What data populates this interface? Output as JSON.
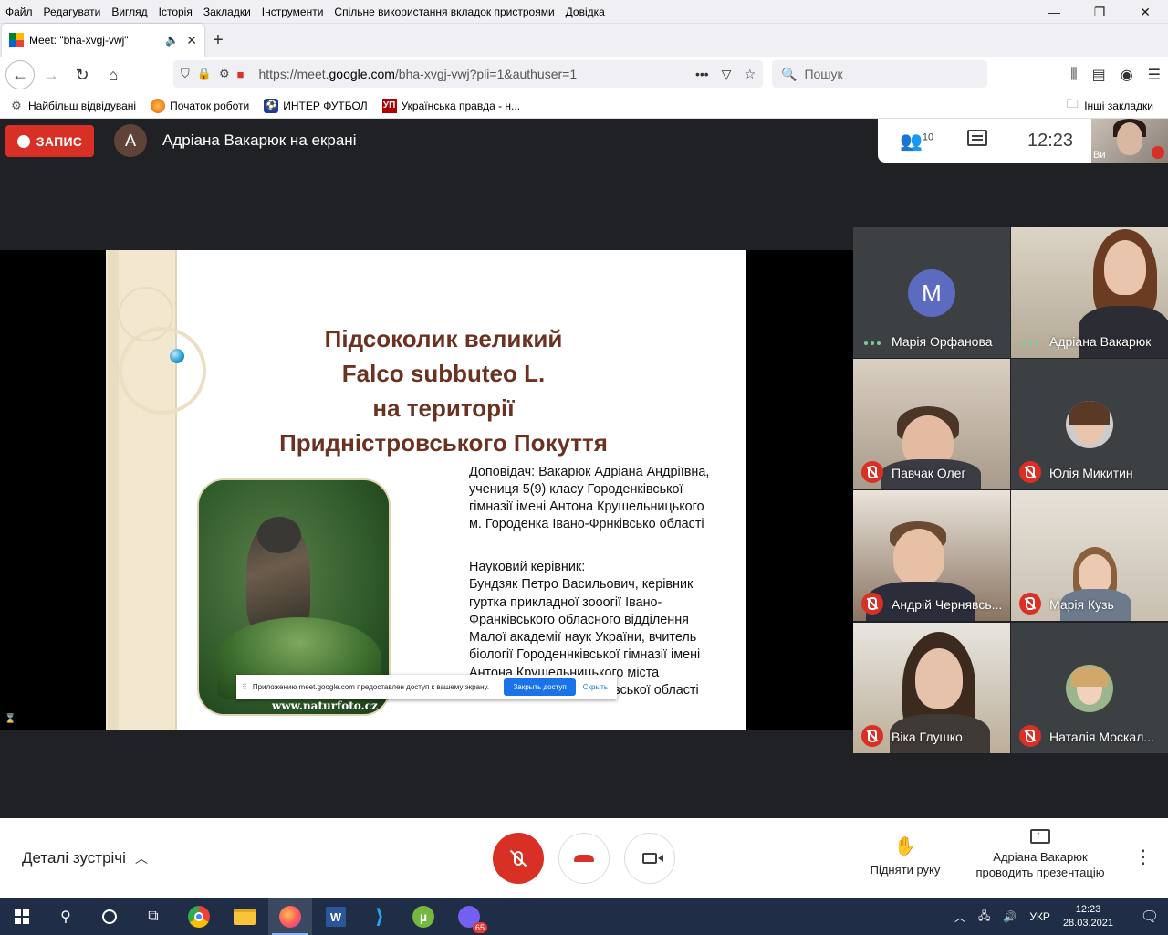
{
  "browser": {
    "menu": [
      "Файл",
      "Редагувати",
      "Вигляд",
      "Історія",
      "Закладки",
      "Інструменти",
      "Спільне використання вкладок пристроями",
      "Довідка"
    ],
    "tab_title": "Meet: \"bha-xvgj-vwj\"",
    "url_prefix": "https://meet.",
    "url_host": "google.com",
    "url_rest": "/bha-xvgj-vwj?pli=1&authuser=1",
    "search_placeholder": "Пошук",
    "bookmarks": [
      {
        "label": "Найбільш відвідувані",
        "icon": "gear-icon"
      },
      {
        "label": "Початок роботи",
        "icon": "firefox-icon"
      },
      {
        "label": "ИНТЕР ФУТБОЛ",
        "icon": "football-icon"
      },
      {
        "label": "Українська правда - н...",
        "icon": "up-icon"
      }
    ],
    "other_bookmarks": "Інші закладки"
  },
  "meet": {
    "record_label": "ЗАПИС",
    "presenter_initial": "А",
    "presenter_text": "Адріана Вакарюк на екрані",
    "participants_count": "10",
    "time": "12:23",
    "self_label": "Ви",
    "colors": {
      "record": "#d93025",
      "mic_off": "#d93025",
      "avatar_m": "#5c6bc0"
    }
  },
  "slide": {
    "title": "Підсоколик великий\nFalco subbuteo L.\nна території\nПридністровського Покуття",
    "speaker": " Доповідач: Вакарюк Адріана Андріївна,\nучениця 5(9) класу Городенківської\nгімназії імені Антона Крушельницького\nм. Городенка Івано-Фрнківсько області",
    "advisor": "  Науковий керівник:\n  Бундзяк Петро Васильович, керівник\nгуртка прикладної зооогії Івано-\nФранківського обласного відділення\nМалої академії наук України,  вчитель\nбіології Городеннківської гімназії імені\nАнтона Крушельницького міста\nГороденка Івано-Франківської області",
    "watermark": "www.naturfoto.cz"
  },
  "share_bar": {
    "message": "Приложению meet.google.com предоставлен доступ к вашему экрану.",
    "stop_label": "Закрыть доступ",
    "hide_label": "Скрыть"
  },
  "participants": [
    {
      "name": "Марія Орфанова",
      "status": "speaking"
    },
    {
      "name": "Адріана Вакарюк",
      "status": "speaking"
    },
    {
      "name": "Павчак Олег",
      "status": "muted"
    },
    {
      "name": "Юлія Микитин",
      "status": "muted"
    },
    {
      "name": "Андрій Чернявсь...",
      "status": "muted"
    },
    {
      "name": "Марія Кузь",
      "status": "muted"
    },
    {
      "name": "Віка Глушко",
      "status": "muted"
    },
    {
      "name": "Наталія Москал...",
      "status": "muted"
    }
  ],
  "avatar_initial": "М",
  "controls": {
    "details_label": "Деталі зустрічі",
    "raise_hand_label": "Підняти руку",
    "presenting_label": "Адріана Вакарюк\nпроводить презентацію"
  },
  "taskbar": {
    "lang": "УКР",
    "time": "12:23",
    "date": "28.03.2021",
    "viber_badge": "65"
  }
}
